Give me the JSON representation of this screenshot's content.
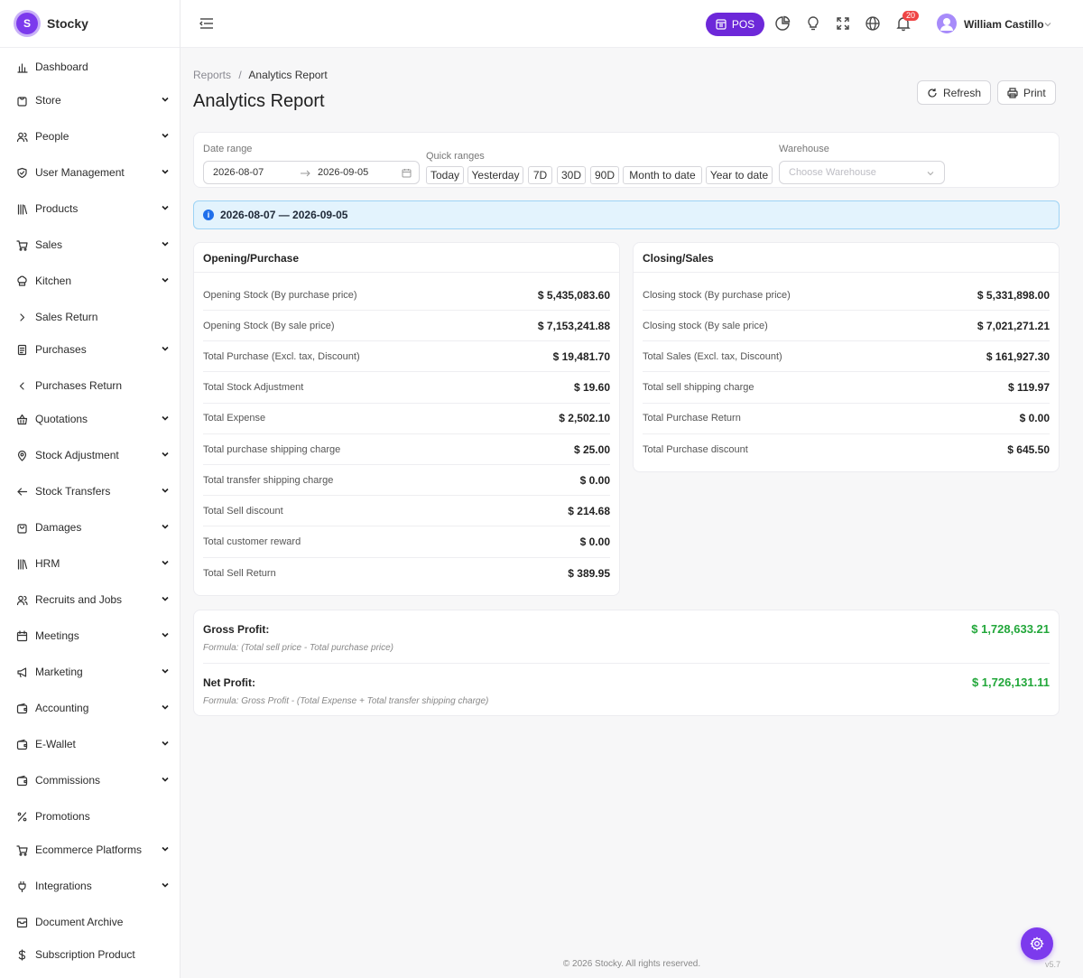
{
  "app": {
    "name": "Stocky",
    "logo_letter": "S"
  },
  "sidebar": {
    "items": [
      {
        "label": "Dashboard",
        "icon": "bar-chart-icon",
        "chevron": ""
      },
      {
        "label": "Store",
        "icon": "store-icon",
        "chevron": "down"
      },
      {
        "label": "People",
        "icon": "users-icon",
        "chevron": "down"
      },
      {
        "label": "User Management",
        "icon": "shield-icon",
        "chevron": "down"
      },
      {
        "label": "Products",
        "icon": "library-icon",
        "chevron": "down"
      },
      {
        "label": "Sales",
        "icon": "cart-icon",
        "chevron": "down"
      },
      {
        "label": "Kitchen",
        "icon": "chef-hat-icon",
        "chevron": "down"
      },
      {
        "label": "Sales Return",
        "icon": "chevron-right-icon",
        "chevron": ""
      },
      {
        "label": "Purchases",
        "icon": "receipt-icon",
        "chevron": "down"
      },
      {
        "label": "Purchases Return",
        "icon": "chevron-left-icon",
        "chevron": ""
      },
      {
        "label": "Quotations",
        "icon": "basket-icon",
        "chevron": "down"
      },
      {
        "label": "Stock Adjustment",
        "icon": "map-pin-icon",
        "chevron": "down"
      },
      {
        "label": "Stock Transfers",
        "icon": "arrow-left-icon",
        "chevron": "down"
      },
      {
        "label": "Damages",
        "icon": "bag-icon",
        "chevron": "down"
      },
      {
        "label": "HRM",
        "icon": "library-icon",
        "chevron": "down"
      },
      {
        "label": "Recruits and Jobs",
        "icon": "users-icon",
        "chevron": "down"
      },
      {
        "label": "Meetings",
        "icon": "calendar-icon",
        "chevron": "down"
      },
      {
        "label": "Marketing",
        "icon": "megaphone-icon",
        "chevron": "down"
      },
      {
        "label": "Accounting",
        "icon": "wallet-icon",
        "chevron": "down"
      },
      {
        "label": "E-Wallet",
        "icon": "wallet-icon",
        "chevron": "down"
      },
      {
        "label": "Commissions",
        "icon": "wallet-icon",
        "chevron": "down"
      },
      {
        "label": "Promotions",
        "icon": "percent-icon",
        "chevron": ""
      },
      {
        "label": "Ecommerce Platforms",
        "icon": "cart-icon",
        "chevron": "down"
      },
      {
        "label": "Integrations",
        "icon": "plug-icon",
        "chevron": "down"
      },
      {
        "label": "Document Archive",
        "icon": "archive-icon",
        "chevron": ""
      },
      {
        "label": "Subscription Product",
        "icon": "dollar-icon",
        "chevron": ""
      }
    ]
  },
  "topbar": {
    "pos_label": "POS",
    "notification_count": "20",
    "user_name": "William Castillo"
  },
  "breadcrumb": {
    "parent": "Reports",
    "separator": "/",
    "current": "Analytics Report"
  },
  "page_title": "Analytics Report",
  "actions": {
    "refresh": "Refresh",
    "print": "Print"
  },
  "filters": {
    "date_range_label": "Date range",
    "start_date": "2026-08-07",
    "end_date": "2026-09-05",
    "quick_ranges_label": "Quick ranges",
    "quick_ranges": [
      "Today",
      "Yesterday",
      "7D",
      "30D",
      "90D",
      "Month to date",
      "Year to date"
    ],
    "warehouse_label": "Warehouse",
    "warehouse_placeholder": "Choose Warehouse"
  },
  "alert_text": "2026-08-07 — 2026-09-05",
  "opening": {
    "title": "Opening/Purchase",
    "rows": [
      {
        "label": "Opening Stock (By purchase price)",
        "value": "$ 5,435,083.60"
      },
      {
        "label": "Opening Stock (By sale price)",
        "value": "$ 7,153,241.88"
      },
      {
        "label": "Total Purchase (Excl. tax, Discount)",
        "value": "$ 19,481.70"
      },
      {
        "label": "Total Stock Adjustment",
        "value": "$ 19.60"
      },
      {
        "label": "Total Expense",
        "value": "$ 2,502.10"
      },
      {
        "label": "Total purchase shipping charge",
        "value": "$ 25.00"
      },
      {
        "label": "Total transfer shipping charge",
        "value": "$ 0.00"
      },
      {
        "label": "Total Sell discount",
        "value": "$ 214.68"
      },
      {
        "label": "Total customer reward",
        "value": "$ 0.00"
      },
      {
        "label": "Total Sell Return",
        "value": "$ 389.95"
      }
    ]
  },
  "closing": {
    "title": "Closing/Sales",
    "rows": [
      {
        "label": "Closing stock (By purchase price)",
        "value": "$ 5,331,898.00"
      },
      {
        "label": "Closing stock (By sale price)",
        "value": "$ 7,021,271.21"
      },
      {
        "label": "Total Sales (Excl. tax, Discount)",
        "value": "$ 161,927.30"
      },
      {
        "label": "Total sell shipping charge",
        "value": "$ 119.97"
      },
      {
        "label": "Total Purchase Return",
        "value": "$ 0.00"
      },
      {
        "label": "Total Purchase discount",
        "value": "$ 645.50"
      }
    ]
  },
  "profit": {
    "gross_label": "Gross Profit:",
    "gross_formula": "Formula: (Total sell price - Total purchase price)",
    "gross_value": "$ 1,728,633.21",
    "net_label": "Net Profit:",
    "net_formula": "Formula: Gross Profit - (Total Expense + Total transfer shipping charge)",
    "net_value": "$ 1,726,131.11"
  },
  "footer": "© 2026 Stocky. All rights reserved.",
  "version": "v5.7",
  "colors": {
    "accent": "#6d28d9",
    "profit": "#22a73a",
    "info_bg": "#e3f3fd"
  }
}
